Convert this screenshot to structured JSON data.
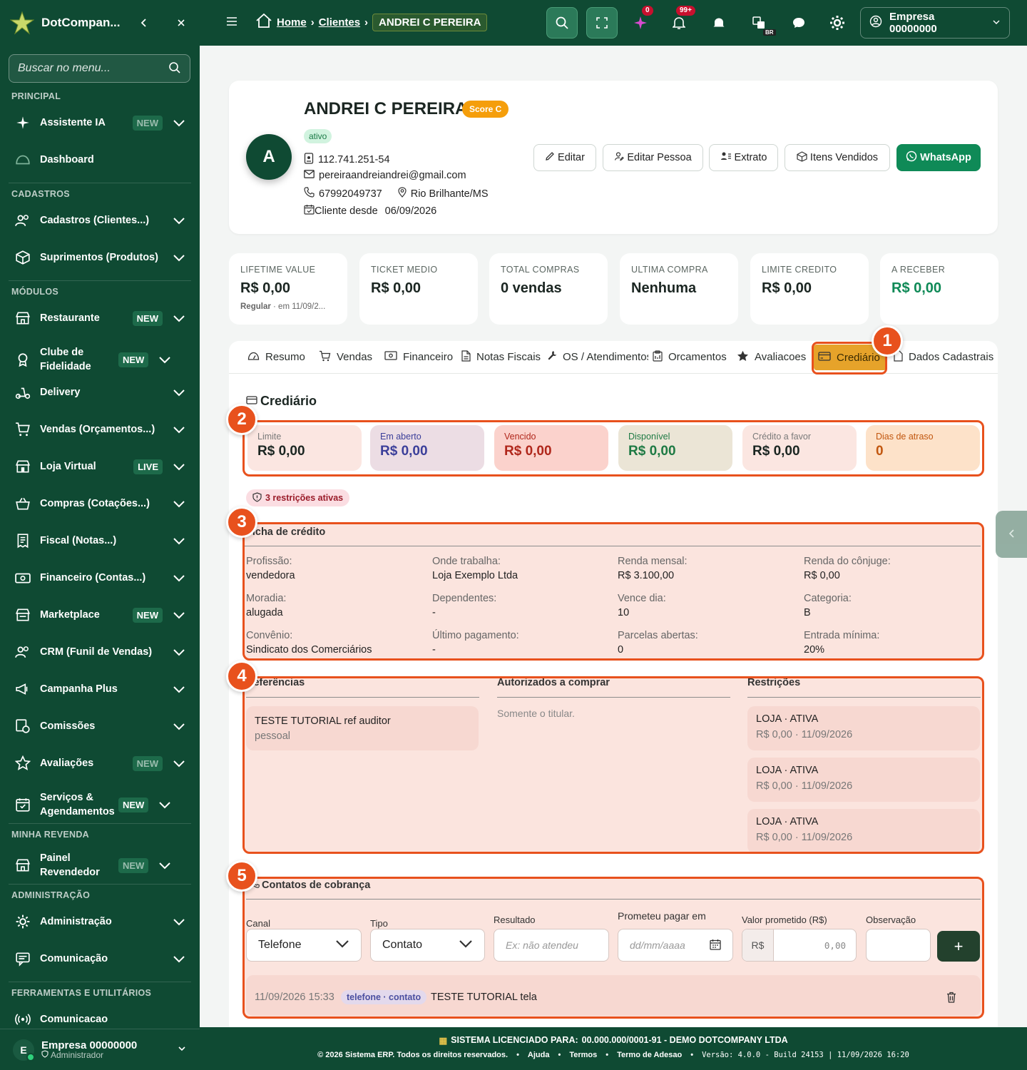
{
  "sidebar": {
    "brand": "DotCompan...",
    "search_placeholder": "Buscar no menu...",
    "sections": {
      "principal": "PRINCIPAL",
      "cadastros": "CADASTROS",
      "modulos": "MÓDULOS",
      "revenda": "MINHA REVENDA",
      "admin": "ADMINISTRAÇÃO",
      "ferramentas": "FERRAMENTAS E UTILITÁRIOS"
    },
    "items": [
      {
        "label": "Assistente IA",
        "badge": "NEW",
        "icon": "sparkle-icon"
      },
      {
        "label": "Dashboard",
        "badge": "",
        "icon": "gauge-icon"
      },
      {
        "label": "Cadastros (Clientes...)",
        "badge": "",
        "icon": "users-icon"
      },
      {
        "label": "Suprimentos (Produtos)",
        "badge": "",
        "icon": "box-icon"
      },
      {
        "label": "Restaurante",
        "badge": "NEW",
        "icon": "store-icon"
      },
      {
        "label": "Clube de Fidelidade",
        "badge": "NEW",
        "icon": "medal-icon"
      },
      {
        "label": "Delivery",
        "badge": "",
        "icon": "scooter-icon"
      },
      {
        "label": "Vendas (Orçamentos...)",
        "badge": "",
        "icon": "cart-icon"
      },
      {
        "label": "Loja Virtual",
        "badge": "LIVE",
        "icon": "shop-icon"
      },
      {
        "label": "Compras (Cotações...)",
        "badge": "",
        "icon": "basket-icon"
      },
      {
        "label": "Fiscal (Notas...)",
        "badge": "",
        "icon": "receipt-icon"
      },
      {
        "label": "Financeiro (Contas...)",
        "badge": "",
        "icon": "cash-icon"
      },
      {
        "label": "Marketplace",
        "badge": "NEW",
        "icon": "marketplace-icon"
      },
      {
        "label": "CRM (Funil de Vendas)",
        "badge": "",
        "icon": "crm-icon"
      },
      {
        "label": "Campanha Plus",
        "badge": "",
        "icon": "megaphone-icon"
      },
      {
        "label": "Comissões",
        "badge": "",
        "icon": "commission-icon"
      },
      {
        "label": "Avaliações",
        "badge": "NEW",
        "icon": "star-icon"
      },
      {
        "label": "Serviços & Agendamentos",
        "badge": "NEW",
        "icon": "calendar-check-icon"
      },
      {
        "label": "Painel Revendedor",
        "badge": "NEW",
        "icon": "store-icon"
      },
      {
        "label": "Administração",
        "badge": "",
        "icon": "gear-icon"
      },
      {
        "label": "Comunicação",
        "badge": "",
        "icon": "chat-icon"
      },
      {
        "label": "Comunicacao",
        "badge": "",
        "icon": "broadcast-icon"
      }
    ],
    "footer": {
      "initial": "E",
      "company": "Empresa 00000000",
      "role": "Administrador"
    }
  },
  "topbar": {
    "breadcrumb": {
      "home": "Home",
      "clientes": "Clientes",
      "current": "ANDREI C PEREIRA"
    },
    "ai_badge": "0",
    "notif_badge": "99+",
    "lang": "BR",
    "user": "Empresa 00000000"
  },
  "profile": {
    "avatar": "A",
    "name": "ANDREI C PEREIRA",
    "score": "Score C",
    "status": "ativo",
    "cpf": "112.741.251-54",
    "email": "pereiraandreiandrei@gmail.com",
    "phone": "67992049737",
    "city": "Rio Brilhante/MS",
    "since_label": "Cliente desde",
    "since": "06/09/2026",
    "buttons": {
      "edit": "Editar",
      "edit_person": "Editar Pessoa",
      "statement": "Extrato",
      "items_sold": "Itens Vendidos",
      "whatsapp": "WhatsApp"
    }
  },
  "kpis": [
    {
      "label": "LIFETIME VALUE",
      "value": "R$ 0,00",
      "sub_bold": "Regular",
      "sub": "· em 11/09/2..."
    },
    {
      "label": "TICKET MEDIO",
      "value": "R$ 0,00"
    },
    {
      "label": "TOTAL COMPRAS",
      "value": "0 vendas"
    },
    {
      "label": "ULTIMA COMPRA",
      "value": "Nenhuma"
    },
    {
      "label": "LIMITE CREDITO",
      "value": "R$ 0,00"
    },
    {
      "label": "A RECEBER",
      "value": "R$ 0,00"
    }
  ],
  "tabs": [
    "Resumo",
    "Vendas",
    "Financeiro",
    "Notas Fiscais",
    "OS / Atendimentos",
    "Orcamentos",
    "Avaliacoes",
    "Crediário",
    "Dados Cadastrais"
  ],
  "annotations": [
    "1",
    "2",
    "3",
    "4",
    "5"
  ],
  "crediario": {
    "title": "Crediário",
    "stats": [
      {
        "label": "Limite",
        "value": "R$ 0,00"
      },
      {
        "label": "Em aberto",
        "value": "R$ 0,00"
      },
      {
        "label": "Vencido",
        "value": "R$ 0,00"
      },
      {
        "label": "Disponível",
        "value": "R$ 0,00"
      },
      {
        "label": "Crédito a favor",
        "value": "R$ 0,00"
      },
      {
        "label": "Dias de atraso",
        "value": "0"
      }
    ],
    "restrictions_badge": "3 restrições ativas",
    "ficha_title": "Ficha de crédito",
    "ficha": [
      {
        "k": "Profissão:",
        "v": "vendedora"
      },
      {
        "k": "Onde trabalha:",
        "v": "Loja Exemplo Ltda"
      },
      {
        "k": "Renda mensal:",
        "v": "R$ 3.100,00"
      },
      {
        "k": "Renda do cônjuge:",
        "v": "R$ 0,00"
      },
      {
        "k": "Moradia:",
        "v": "alugada"
      },
      {
        "k": "Dependentes:",
        "v": "-"
      },
      {
        "k": "Vence dia:",
        "v": "10"
      },
      {
        "k": "Categoria:",
        "v": "B"
      },
      {
        "k": "Convênio:",
        "v": "Sindicato dos Comerciários"
      },
      {
        "k": "Último pagamento:",
        "v": "-"
      },
      {
        "k": "Parcelas abertas:",
        "v": "0"
      },
      {
        "k": "Entrada mínima:",
        "v": "20%"
      }
    ],
    "refs_title": "Referências",
    "refs": [
      {
        "name": "TESTE TUTORIAL ref auditor",
        "type": "pessoal"
      }
    ],
    "auth_title": "Autorizados a comprar",
    "auth_empty": "Somente o titular.",
    "restr_title": "Restrições",
    "restrictions": [
      {
        "title": "LOJA · ATIVA",
        "detail": "R$ 0,00 · 11/09/2026"
      },
      {
        "title": "LOJA · ATIVA",
        "detail": "R$ 0,00 · 11/09/2026"
      },
      {
        "title": "LOJA · ATIVA",
        "detail": "R$ 0,00 · 11/09/2026"
      }
    ],
    "contacts_title": "Contatos de cobrança",
    "form": {
      "canal_label": "Canal",
      "canal_value": "Telefone",
      "tipo_label": "Tipo",
      "tipo_value": "Contato",
      "resultado_label": "Resultado",
      "resultado_placeholder": "Ex: não atendeu",
      "prometeu_label": "Prometeu pagar em",
      "prometeu_placeholder": "dd/mm/aaaa",
      "valor_label": "Valor prometido (R$)",
      "valor_prefix": "R$",
      "valor_placeholder": "0,00",
      "obs_label": "Observação",
      "add": "+"
    },
    "log": {
      "datetime": "11/09/2026 15:33",
      "tag": "telefone · contato",
      "text": "TESTE TUTORIAL tela"
    }
  },
  "footer": {
    "license_label": "SISTEMA LICENCIADO PARA:",
    "license_value": "00.000.000/0001-91 - DEMO DOTCOMPANY LTDA",
    "copyright": "© 2026 Sistema ERP. Todos os direitos reservados.",
    "links": [
      "Ajuda",
      "Termos",
      "Termo de Adesao"
    ],
    "version": "Versão: 4.0.0 - Build 24153 | 11/09/2026 16:20"
  },
  "colors": {
    "brand": "#0f4a33",
    "accent": "#e8511d",
    "active_tab": "#e6a32a",
    "whatsapp": "#0f8a57"
  }
}
